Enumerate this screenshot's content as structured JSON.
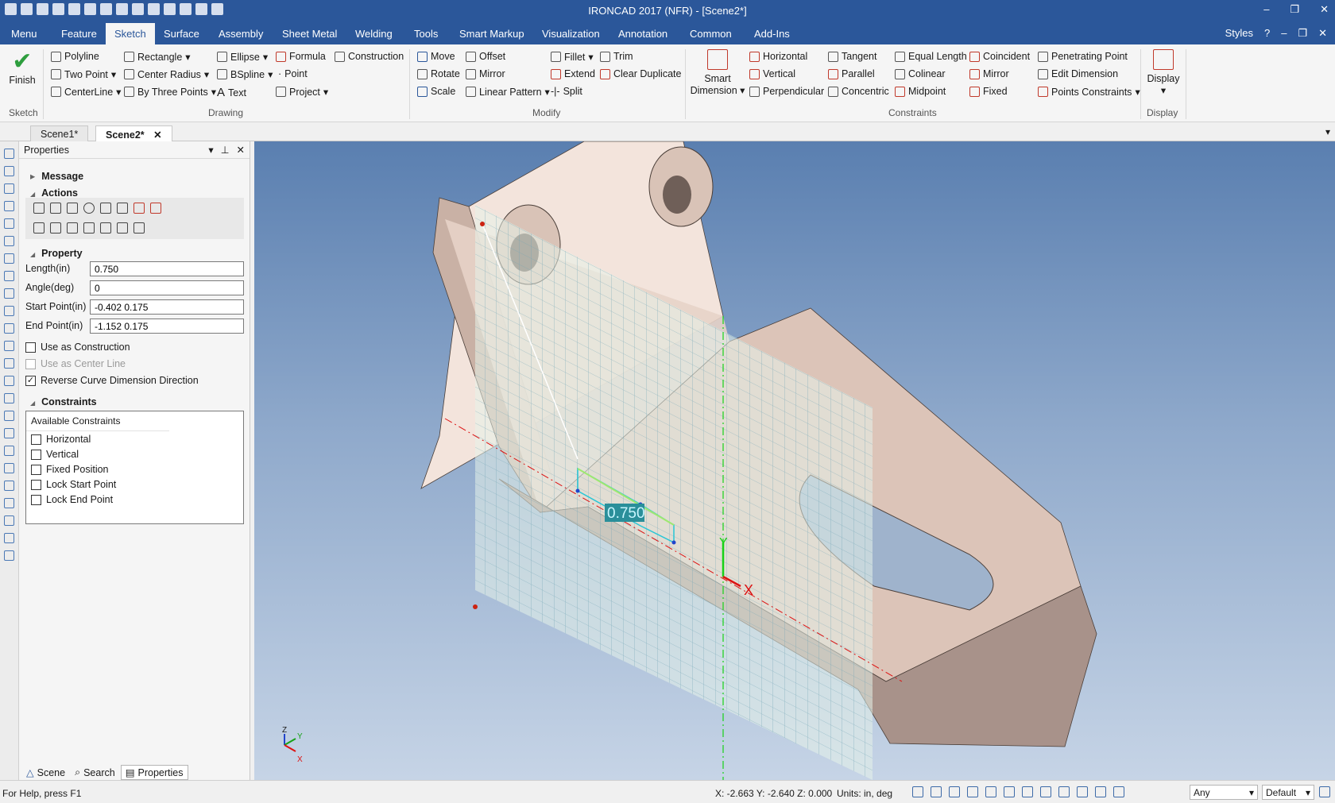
{
  "titlebar": {
    "title": "IRONCAD 2017 (NFR) - [Scene2*]",
    "minimize": "–",
    "restore": "❐",
    "close": "✕"
  },
  "menu": {
    "tabs": [
      "Menu",
      "Feature",
      "Sketch",
      "Surface",
      "Assembly",
      "Sheet Metal",
      "Welding",
      "Tools",
      "Smart Markup",
      "Visualization",
      "Annotation",
      "Common",
      "Add-Ins"
    ],
    "active": "Sketch",
    "styles": "Styles"
  },
  "ribbon": {
    "finish": "Finish",
    "drawing": [
      "Polyline",
      "Rectangle",
      "Ellipse",
      "Formula",
      "Construction",
      "Two Point",
      "Center Radius",
      "BSpline",
      "Point",
      "CenterLine",
      "By Three Points",
      "Text",
      "Project"
    ],
    "modify": [
      "Move",
      "Offset",
      "Fillet",
      "Trim",
      "Rotate",
      "Mirror",
      "Extend",
      "Clear Duplicate",
      "Scale",
      "Linear Pattern",
      "Split"
    ],
    "smart_dimension": [
      "Smart",
      "Dimension"
    ],
    "constraints": [
      "Horizontal",
      "Tangent",
      "Equal Length",
      "Coincident",
      "Penetrating Point",
      "Vertical",
      "Parallel",
      "Colinear",
      "Mirror",
      "Edit Dimension",
      "Perpendicular",
      "Concentric",
      "Midpoint",
      "Fixed",
      "Points Constraints"
    ],
    "display": "Display",
    "groups": {
      "sketch": "Sketch",
      "drawing": "Drawing",
      "modify": "Modify",
      "constraints": "Constraints",
      "display": "Display"
    }
  },
  "doctabs": [
    "Scene1*",
    "Scene2*"
  ],
  "panel": {
    "title": "Properties",
    "message": "Message",
    "actions": "Actions",
    "property": "Property",
    "length_label": "Length(in)",
    "length": "0.750",
    "angle_label": "Angle(deg)",
    "angle": "0",
    "start_label": "Start Point(in)",
    "start": "-0.402 0.175",
    "end_label": "End Point(in)",
    "end": "-1.152 0.175",
    "use_construction": "Use as Construction",
    "use_centerline": "Use as Center Line",
    "reverse_dim": "Reverse Curve Dimension Direction",
    "reverse_dim_checked": true,
    "constraints": "Constraints",
    "available": "Available Constraints",
    "constraint_items": [
      "Horizontal",
      "Vertical",
      "Fixed Position",
      "Lock Start Point",
      "Lock End Point"
    ],
    "bottom_tabs": [
      "Scene",
      "Search",
      "Properties"
    ]
  },
  "viewport": {
    "dimension": "0.750",
    "axis_x": "X",
    "axis_y": "Y",
    "triad": {
      "z": "Z",
      "y": "Y",
      "x": "X"
    }
  },
  "status": {
    "help": "For Help, press F1",
    "coords": "X: -2.663 Y: -2.640 Z: 0.000",
    "units": "Units: in, deg",
    "filter": "Any",
    "style": "Default"
  }
}
